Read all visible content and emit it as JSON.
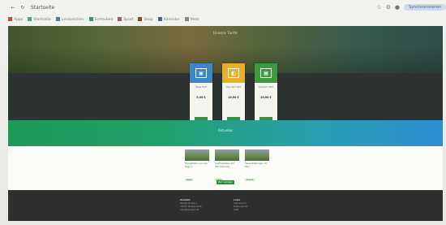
{
  "browser": {
    "nav_back": "←",
    "nav_reload": "↻",
    "tab_title": "Startseite",
    "toolbar_pill": "Synchronisieren"
  },
  "bookmarks": [
    "Apps",
    "Startseite",
    "Lesezeichen",
    "Formulare",
    "Sport",
    "Shop",
    "Kalender",
    "Mehr"
  ],
  "hero": {
    "title": "Unsere Tarife"
  },
  "plans": [
    {
      "title": "Basis Tarif",
      "price": "9,99 €",
      "button": "Buchen",
      "color": "#3e86c6",
      "icon": "▣"
    },
    {
      "title": "Standard Tarif",
      "price": "19,99 €",
      "button": "Buchen",
      "color": "#e6b12a",
      "icon": "◧"
    },
    {
      "title": "Premium Tarif",
      "price": "29,99 €",
      "button": "Buchen",
      "color": "#3f9a3f",
      "icon": "▦"
    }
  ],
  "section": {
    "title": "Aktuelles"
  },
  "articles": [
    {
      "caption": "Neuigkeiten aus der Region",
      "tag": "News"
    },
    {
      "caption": "Ausflugstipps am Wochenende",
      "tag": "Tipps"
    },
    {
      "caption": "Veranstaltungen im Park",
      "tag": "Events"
    }
  ],
  "more_button": "Mehr anzeigen",
  "footer": {
    "col1_head": "Kontakt",
    "col1_lines": [
      "Musterstraße 1",
      "12345 Musterstadt",
      "info@beispiel.de"
    ],
    "col2_head": "Links",
    "col2_lines": [
      "Impressum",
      "Datenschutz",
      "AGB"
    ]
  }
}
